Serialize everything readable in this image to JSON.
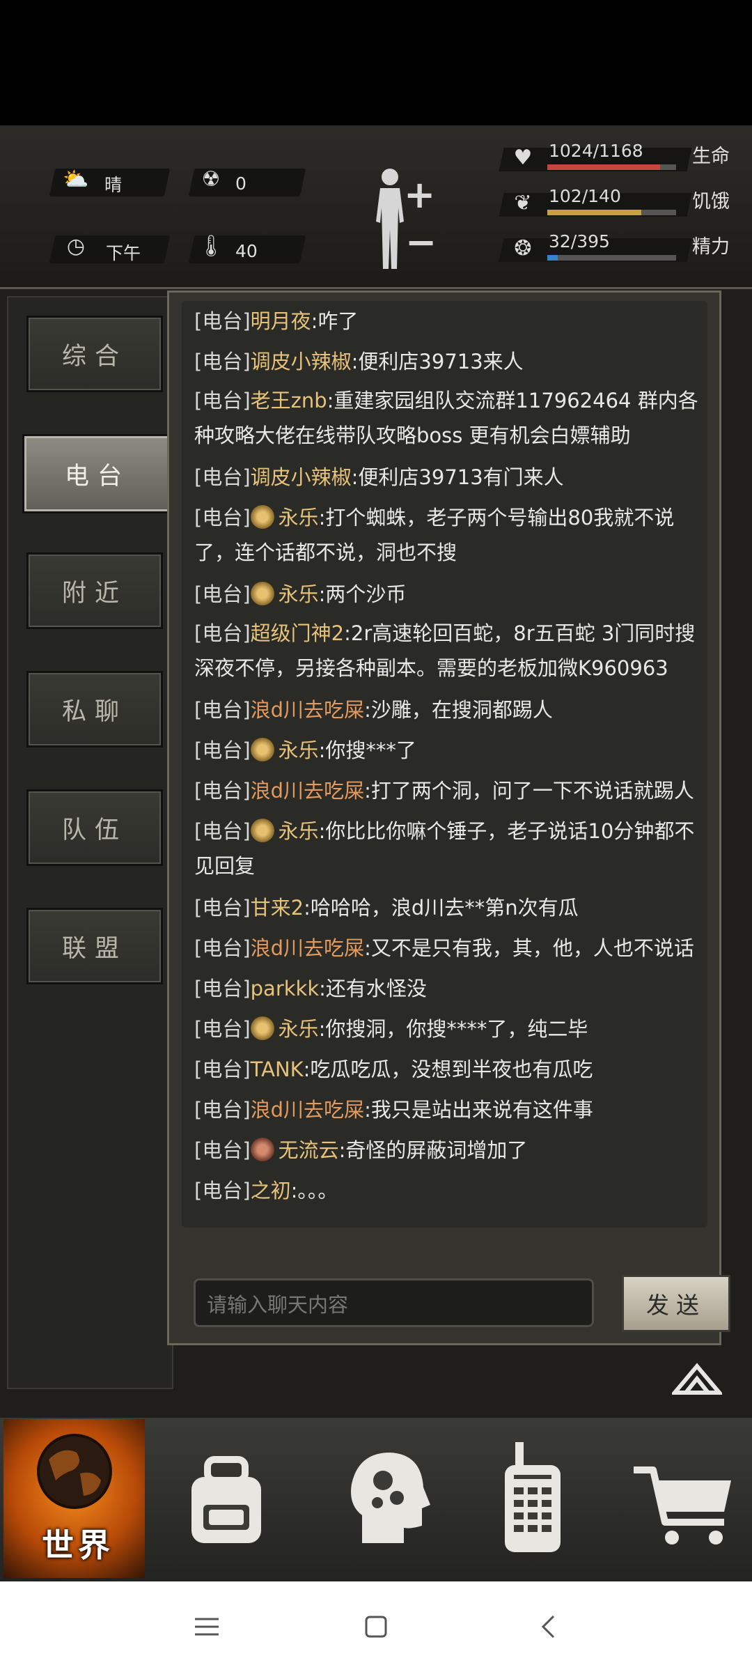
{
  "status": {
    "weather_icon": "cloud-sun-icon",
    "weather": "晴",
    "radiation_icon": "radiation-icon",
    "radiation": "0",
    "time_icon": "clock-icon",
    "time": "下午",
    "temperature_icon": "thermometer-icon",
    "temperature": "40"
  },
  "stats": {
    "health": {
      "value": "1024/1168",
      "label": "生命",
      "fraction": 0.877,
      "color": "#c8473d"
    },
    "hunger": {
      "value": "102/140",
      "label": "饥饿",
      "fraction": 0.729,
      "color": "#c6a043"
    },
    "energy": {
      "value": "32/395",
      "label": "精力",
      "fraction": 0.081,
      "color": "#3b7fd0"
    }
  },
  "tabs": [
    {
      "label": "综合"
    },
    {
      "label": "电台"
    },
    {
      "label": "附近"
    },
    {
      "label": "私聊"
    },
    {
      "label": "队伍"
    },
    {
      "label": "联盟"
    }
  ],
  "active_tab": "电台",
  "messages": [
    {
      "tag": "[电台]",
      "name": "明月夜",
      "name_color": "#e7c27a",
      "text": ":咋了"
    },
    {
      "tag": "[电台]",
      "name": "调皮小辣椒",
      "name_color": "#e7c27a",
      "text": ":便利店39713来人"
    },
    {
      "tag": "[电台]",
      "name": "老王znb",
      "name_color": "#e7c27a",
      "text": ":重建家园组队交流群117962464 群内各种攻略大佬在线带队攻略boss 更有机会白嫖辅助"
    },
    {
      "tag": "[电台]",
      "name": "调皮小辣椒",
      "name_color": "#e7c27a",
      "text": ":便利店39713有门来人"
    },
    {
      "tag": "[电台]",
      "badge": "gold",
      "name": "永乐",
      "name_color": "#e7c27a",
      "text": ":打个蜘蛛，老子两个号输出80我就不说了，连个话都不说，洞也不搜"
    },
    {
      "tag": "[电台]",
      "badge": "gold",
      "name": "永乐",
      "name_color": "#e7c27a",
      "text": ":两个沙币"
    },
    {
      "tag": "[电台]",
      "name": "超级门神2",
      "name_color": "#e7c27a",
      "text": ":2r高速轮回百蛇，8r五百蛇 3门同时搜深夜不停，另接各种副本。需要的老板加微K960963"
    },
    {
      "tag": "[电台]",
      "name": "浪d川去吃屎",
      "name_color": "#e39a5f",
      "text": ":沙雕，在搜洞都踢人"
    },
    {
      "tag": "[电台]",
      "badge": "gold",
      "name": "永乐",
      "name_color": "#e7c27a",
      "text": ":你搜***了"
    },
    {
      "tag": "[电台]",
      "name": "浪d川去吃屎",
      "name_color": "#e39a5f",
      "text": ":打了两个洞，问了一下不说话就踢人"
    },
    {
      "tag": "[电台]",
      "badge": "gold",
      "name": "永乐",
      "name_color": "#e7c27a",
      "text": ":你比比你嘛个锤子，老子说话10分钟都不见回复"
    },
    {
      "tag": "[电台]",
      "name": "甘来2",
      "name_color": "#e7c27a",
      "text": ":哈哈哈，浪d川去**第n次有瓜"
    },
    {
      "tag": "[电台]",
      "name": "浪d川去吃屎",
      "name_color": "#e39a5f",
      "text": ":又不是只有我，其，他，人也不说话"
    },
    {
      "tag": "[电台]",
      "name": "parkkk",
      "name_color": "#e7c27a",
      "text": ":还有水怪没"
    },
    {
      "tag": "[电台]",
      "badge": "gold",
      "name": "永乐",
      "name_color": "#e7c27a",
      "text": ":你搜洞，你搜****了，纯二毕"
    },
    {
      "tag": "[电台]",
      "name": "TANK",
      "name_color": "#e7c27a",
      "text": ":吃瓜吃瓜，没想到半夜也有瓜吃"
    },
    {
      "tag": "[电台]",
      "name": "浪d川去吃屎",
      "name_color": "#e39a5f",
      "text": ":我只是站出来说有这件事"
    },
    {
      "tag": "[电台]",
      "badge": "red",
      "name": "无流云",
      "name_color": "#e7c27a",
      "text": ":奇怪的屏蔽词增加了"
    },
    {
      "tag": "[电台]",
      "name": "之初",
      "name_color": "#e7c27a",
      "text": ":。。。"
    }
  ],
  "chat_input": {
    "placeholder": "请输入聊天内容"
  },
  "send_label": "发送",
  "bottom_nav": {
    "world_label": "世界",
    "items": [
      "globe-icon",
      "backpack-icon",
      "brain-head-icon",
      "walkie-talkie-icon",
      "shopping-cart-icon"
    ]
  },
  "android_nav": [
    "menu-icon",
    "home-icon",
    "back-icon"
  ]
}
